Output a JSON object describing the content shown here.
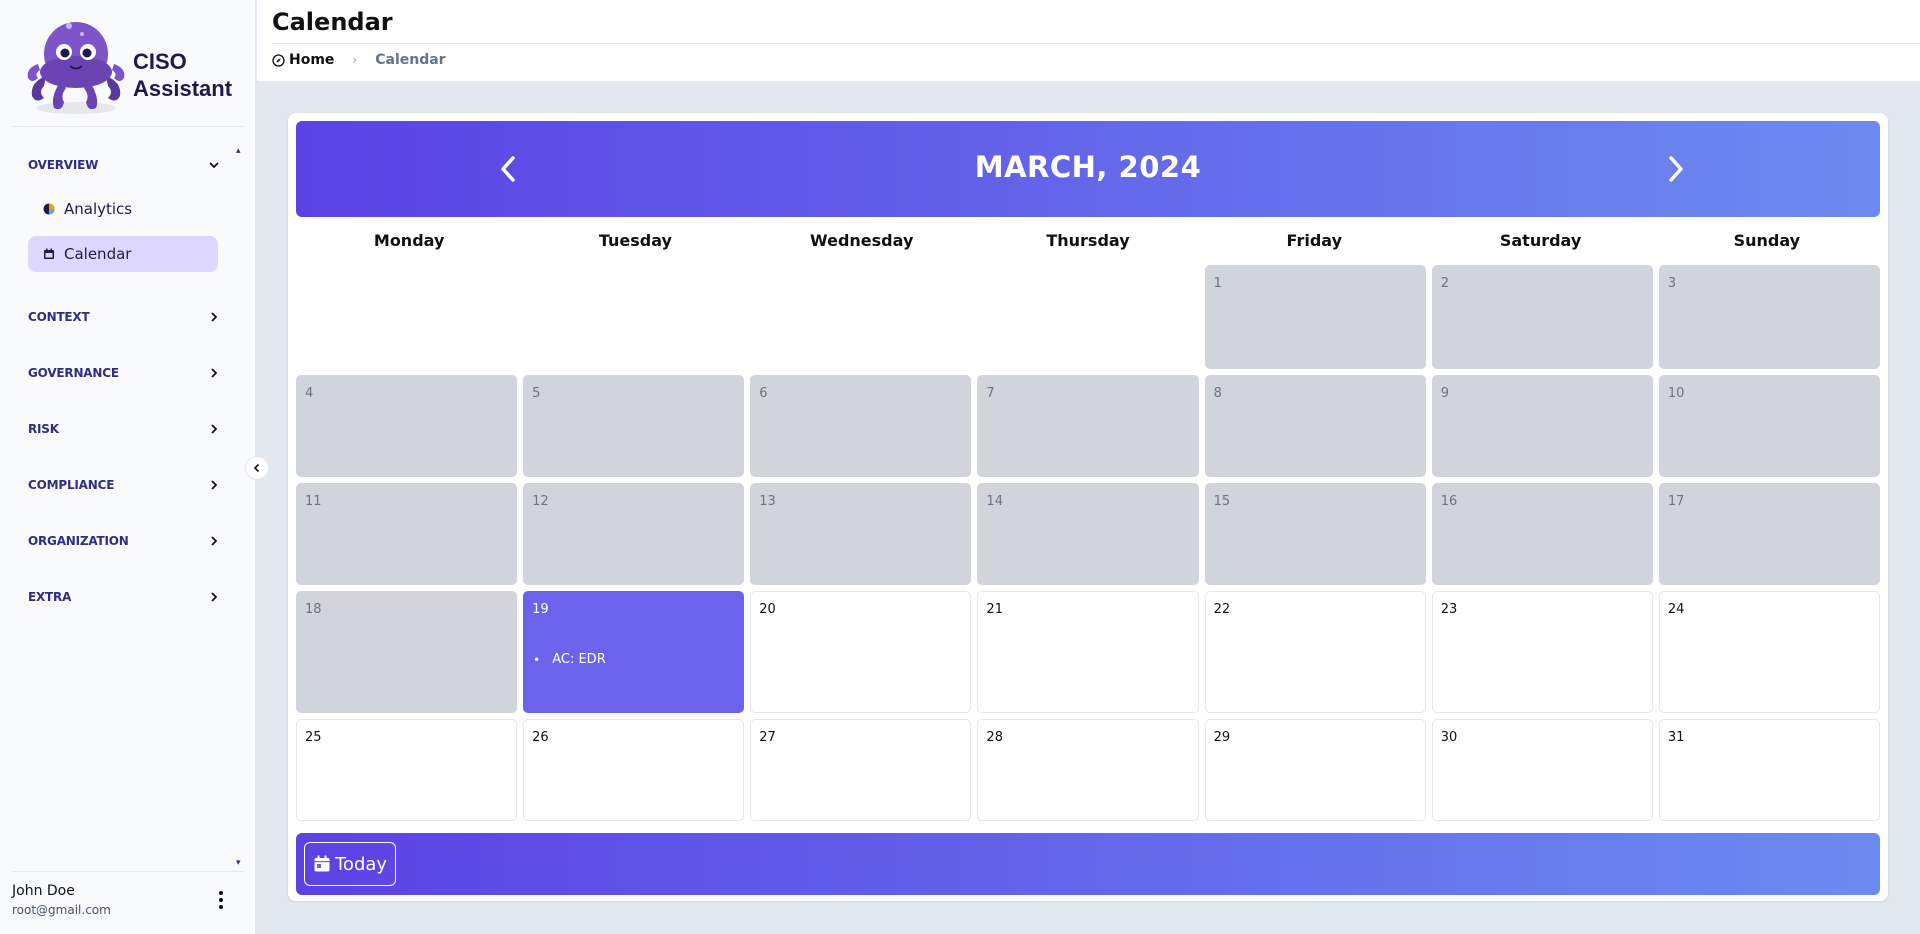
{
  "sidebar": {
    "logo_line1": "CISO",
    "logo_line2": "Assistant",
    "groups": [
      {
        "label": "OVERVIEW",
        "expanded": true
      },
      {
        "label": "CONTEXT"
      },
      {
        "label": "GOVERNANCE"
      },
      {
        "label": "RISK"
      },
      {
        "label": "COMPLIANCE"
      },
      {
        "label": "ORGANIZATION"
      },
      {
        "label": "EXTRA"
      }
    ],
    "items": [
      {
        "label": "Analytics",
        "icon": "chart-pie-icon"
      },
      {
        "label": "Calendar",
        "icon": "calendar-icon",
        "active": true
      }
    ],
    "user": {
      "name": "John Doe",
      "email": "root@gmail.com"
    }
  },
  "header": {
    "title": "Calendar",
    "breadcrumb": {
      "home": "Home",
      "current": "Calendar"
    }
  },
  "calendar": {
    "month_label": "MARCH, 2024",
    "weekdays": [
      "Monday",
      "Tuesday",
      "Wednesday",
      "Thursday",
      "Friday",
      "Saturday",
      "Sunday"
    ],
    "today_label": "Today",
    "event": "AC: EDR",
    "today_day": 19,
    "colors": {
      "accent_start": "#5b42e4",
      "accent_end": "#6c8bf0",
      "today": "#6c63ec",
      "past": "#d1d5db"
    }
  }
}
